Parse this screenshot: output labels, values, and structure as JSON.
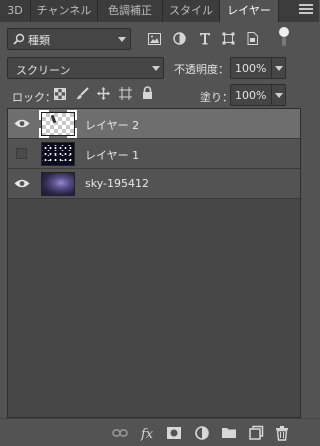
{
  "tabs": [
    {
      "label": "3D",
      "active": false
    },
    {
      "label": "チャンネル",
      "active": false
    },
    {
      "label": "色調補正",
      "active": false
    },
    {
      "label": "スタイル",
      "active": false
    },
    {
      "label": "レイヤー",
      "active": true
    }
  ],
  "filter": {
    "label": "種類"
  },
  "blend_mode": {
    "value": "スクリーン"
  },
  "opacity": {
    "label": "不透明度：",
    "value": "100%"
  },
  "lock": {
    "label": "ロック："
  },
  "fill": {
    "label": "塗り：",
    "value": "100%"
  },
  "layers": [
    {
      "name": "レイヤー 2",
      "visible": true,
      "selected": true
    },
    {
      "name": "レイヤー 1",
      "visible": false,
      "selected": false
    },
    {
      "name": "sky-195412",
      "visible": true,
      "selected": false
    }
  ],
  "bottom_icons": [
    "link-icon",
    "fx-icon",
    "mask-icon",
    "adjustment-icon",
    "folder-icon",
    "new-layer-icon",
    "trash-icon"
  ],
  "colors": {
    "panel": "#535353",
    "tabbar": "#3c3c3c",
    "selected_row": "#6e6e6e"
  }
}
